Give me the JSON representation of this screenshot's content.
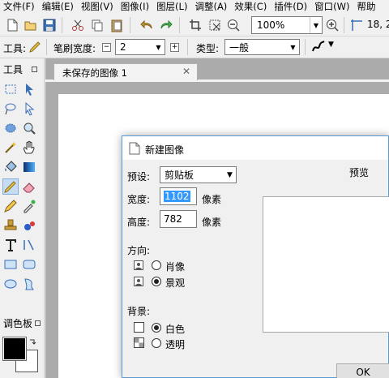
{
  "menu": [
    "文件(F)",
    "编辑(E)",
    "视图(V)",
    "图像(I)",
    "图层(L)",
    "调整(A)",
    "效果(C)",
    "插件(D)",
    "窗口(W)",
    "帮助"
  ],
  "toolbar": {
    "zoom_value": "100%",
    "coord_readout": "18, 2"
  },
  "tool_options": {
    "tool_label": "工具:",
    "brush_width_label": "笔刷宽度:",
    "brush_width_value": "2",
    "type_label": "类型:",
    "type_value": "一般"
  },
  "tools_panel": {
    "title": "工具"
  },
  "palette_panel": {
    "title": "调色板"
  },
  "document": {
    "tab_title": "未保存的图像 1"
  },
  "dialog": {
    "title": "新建图像",
    "preset_label": "预设:",
    "preset_value": "剪贴板",
    "preview_label": "预览",
    "width_label": "宽度:",
    "width_value": "1102",
    "width_unit": "像素",
    "height_label": "高度:",
    "height_value": "782",
    "height_unit": "像素",
    "orientation_label": "方向:",
    "portrait_label": "肖像",
    "landscape_label": "景观",
    "orientation_selected": "landscape",
    "background_label": "背景:",
    "white_label": "白色",
    "transparent_label": "透明",
    "background_selected": "white",
    "ok_label": "OK"
  },
  "colors": {
    "accent": "#5b9bd5",
    "selection": "#3399ff",
    "primary_color": "#000000",
    "secondary_color": "#ffffff"
  }
}
